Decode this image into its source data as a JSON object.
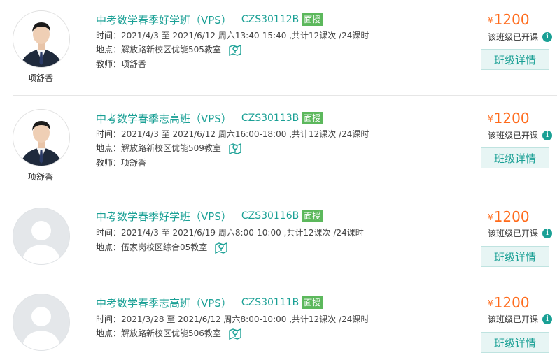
{
  "courses": [
    {
      "title": "中考数学春季好学班（VPS）",
      "code": "CZS30112B",
      "mode": "面授",
      "time_label": "时间：",
      "time": "2021/4/3 至 2021/6/12 周六13:40-15:40 ,共计12课次 /24课时",
      "location_label": "地点：",
      "location": "解放路新校区优能505教室",
      "teacher_label": "教师：",
      "teacher": "项舒香",
      "avatar_caption": "项舒香",
      "currency": "¥",
      "price": "1200",
      "status": "该班级已开课",
      "detail_button": "班级详情",
      "has_photo": true
    },
    {
      "title": "中考数学春季志高班（VPS）",
      "code": "CZS30113B",
      "mode": "面授",
      "time_label": "时间：",
      "time": "2021/4/3 至 2021/6/12 周六16:00-18:00 ,共计12课次 /24课时",
      "location_label": "地点：",
      "location": "解放路新校区优能509教室",
      "teacher_label": "教师：",
      "teacher": "项舒香",
      "avatar_caption": "项舒香",
      "currency": "¥",
      "price": "1200",
      "status": "该班级已开课",
      "detail_button": "班级详情",
      "has_photo": true
    },
    {
      "title": "中考数学春季好学班（VPS）",
      "code": "CZS30116B",
      "mode": "面授",
      "time_label": "时间：",
      "time": "2021/4/3 至 2021/6/19 周六8:00-10:00 ,共计12课次 /24课时",
      "location_label": "地点：",
      "location": "伍家岗校区综合05教室",
      "currency": "¥",
      "price": "1200",
      "status": "该班级已开课",
      "detail_button": "班级详情",
      "has_photo": false
    },
    {
      "title": "中考数学春季志高班（VPS）",
      "code": "CZS30111B",
      "mode": "面授",
      "time_label": "时间：",
      "time": "2021/3/28 至 2021/6/12 周六8:00-10:00 ,共计12课次 /24课时",
      "location_label": "地点：",
      "location": "解放路新校区优能506教室",
      "currency": "¥",
      "price": "1200",
      "status": "该班级已开课",
      "detail_button": "班级详情",
      "has_photo": false
    }
  ],
  "colors": {
    "accent": "#1aa095",
    "price": "#ff6a1a",
    "badge": "#5cb85c"
  },
  "icons": {
    "map": "map-pin-icon",
    "info": "info-icon",
    "avatar_placeholder": "avatar-placeholder-icon"
  }
}
